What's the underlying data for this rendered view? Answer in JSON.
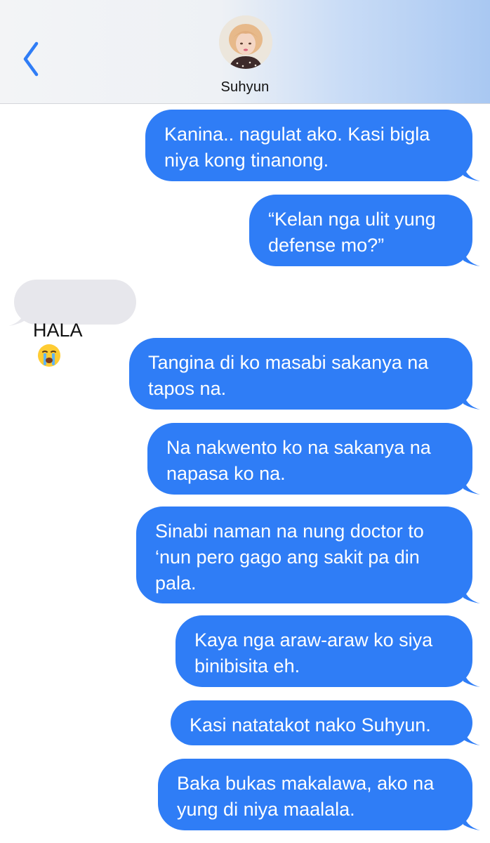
{
  "header": {
    "contact_name": "Suhyun",
    "back_icon": "chevron-left-icon",
    "avatar_icon": "contact-avatar"
  },
  "colors": {
    "outgoing_bubble": "#2f7df6",
    "incoming_bubble": "#e7e7ec",
    "accent": "#2f7df6"
  },
  "messages": [
    {
      "direction": "outgoing",
      "text": "Kanina.. nagulat ako. Kasi bigla\nniya kong tinanong."
    },
    {
      "direction": "outgoing",
      "text": "“Kelan nga ulit yung\ndefense mo?”"
    },
    {
      "direction": "incoming",
      "text": "HALA",
      "emoji": "loudly-crying-face"
    },
    {
      "direction": "outgoing",
      "text": "Tangina di ko masabi sakanya na\ntapos na."
    },
    {
      "direction": "outgoing",
      "text": "Na nakwento ko na sakanya na\nnapasa ko na."
    },
    {
      "direction": "outgoing",
      "text": "Sinabi naman na nung doctor to\n‘nun pero gago ang sakit pa din\npala."
    },
    {
      "direction": "outgoing",
      "text": "Kaya nga araw-araw ko siya\nbinibisita eh."
    },
    {
      "direction": "outgoing",
      "text": "Kasi natatakot nako Suhyun."
    },
    {
      "direction": "outgoing",
      "text": "Baka bukas makalawa, ako na\nyung di niya maalala."
    }
  ]
}
